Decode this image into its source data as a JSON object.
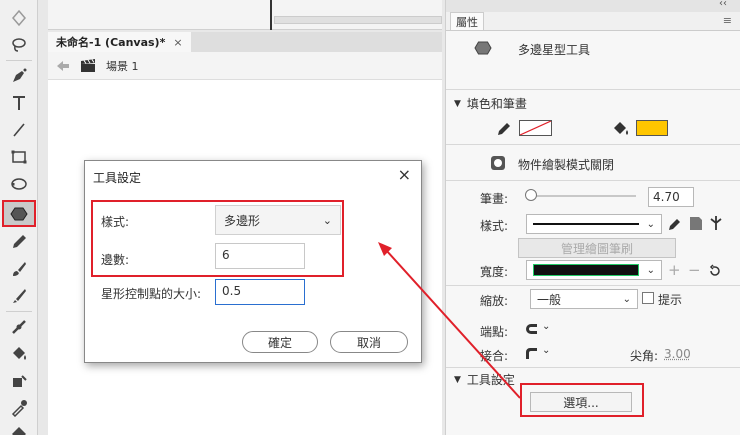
{
  "document_tab": {
    "title": "未命名-1 (Canvas)*",
    "close": "×"
  },
  "scene": {
    "label": "場景 1"
  },
  "panel": {
    "tab_label": "屬性",
    "collapse": "‹‹",
    "menu": "≡",
    "tool_name": "多邊星型工具",
    "fill_stroke": {
      "header": "填色和筆畫",
      "stroke_color": "#ffffff",
      "fill_color": "#ffc600"
    },
    "object_draw": {
      "label": "物件繪製模式關閉"
    },
    "stroke": {
      "label": "筆畫:",
      "value": "4.70"
    },
    "style": {
      "label": "樣式:"
    },
    "brush_button": "管理繪圖筆刷",
    "width": {
      "label": "寬度:"
    },
    "scale": {
      "label": "縮放:",
      "value": "一般",
      "hint_label": "提示"
    },
    "cap": {
      "label": "端點:"
    },
    "join": {
      "label": "接合:",
      "miter_label": "尖角:",
      "miter_value": "3.00"
    },
    "tool_settings": {
      "header": "工具設定",
      "options_button": "選項..."
    }
  },
  "dialog": {
    "title": "工具設定",
    "close": "×",
    "style_label": "樣式:",
    "style_value": "多邊形",
    "sides_label": "邊數:",
    "sides_value": "6",
    "star_point_label": "星形控制點的大小:",
    "star_point_value": "0.5",
    "ok": "確定",
    "cancel": "取消"
  },
  "colors": {
    "highlight": "#e0202a",
    "arrow": "#e0202a"
  }
}
